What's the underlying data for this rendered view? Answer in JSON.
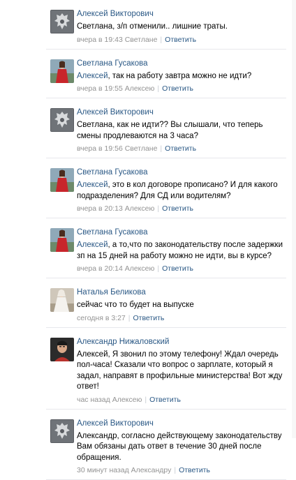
{
  "comments": [
    {
      "avatar": "coat-of-arms-avatar",
      "author": "Алексей Викторович",
      "mention": "",
      "text": "Светлана, з/п отменили.. лишние траты.",
      "meta": "вчера в 19:43 Светлане",
      "reply": "Ответить"
    },
    {
      "avatar": "woman-red-dress-avatar",
      "author": "Светлана Гусакова",
      "mention": "Алексей",
      "text": ", так на работу завтра можно не идти?",
      "meta": "вчера в 19:55 Алексею",
      "reply": "Ответить"
    },
    {
      "avatar": "coat-of-arms-avatar",
      "author": "Алексей Викторович",
      "mention": "",
      "text": "Светлана, как не идти?? Вы слышали, что теперь смены продлеваются на 3 часа?",
      "meta": "вчера в 19:56 Светлане",
      "reply": "Ответить"
    },
    {
      "avatar": "woman-red-dress-avatar",
      "author": "Светлана Гусакова",
      "mention": "Алексей",
      "text": ", это в кол договоре прописано? И для какого подразделения? Для СД или водителям?",
      "meta": "вчера в 20:13 Алексею",
      "reply": "Ответить"
    },
    {
      "avatar": "woman-red-dress-avatar",
      "author": "Светлана Гусакова",
      "mention": "Алексей",
      "text": ", а то,что по законодательству после задержки зп на 15 дней на работу можно не идти, вы в курсе?",
      "meta": "вчера в 20:14 Алексею",
      "reply": "Ответить"
    },
    {
      "avatar": "bride-avatar",
      "author": "Наталья Беликова",
      "mention": "",
      "text": "сейчас что то будет на выпуске",
      "meta": "сегодня в 3:27",
      "reply": "Ответить"
    },
    {
      "avatar": "man-portrait-avatar",
      "author": "Александр Нижаловский",
      "mention": "",
      "text": "Алексей, Я звонил по этому телефону! Ждал очередь пол-часа! Сказали что вопрос о зарплате, который я задал, направят в профильные министерства! Вот жду ответ!",
      "meta": "час назад Алексею",
      "reply": "Ответить"
    },
    {
      "avatar": "coat-of-arms-avatar",
      "author": "Алексей Викторович",
      "mention": "",
      "text": "Александр, согласно действующему законодательству Вам обязаны дать ответ в течение 30 дней после обращения.",
      "meta": "30 минут назад Александру",
      "reply": "Ответить"
    }
  ]
}
